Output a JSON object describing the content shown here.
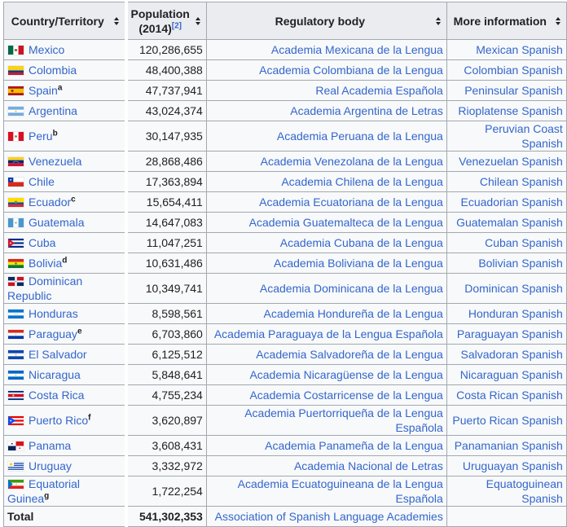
{
  "table": {
    "headers": {
      "country": "Country/Territory",
      "population": "Population (2014)",
      "population_line1": "Population",
      "population_line2": "(2014)",
      "population_ref": "[2]",
      "regulatory": "Regulatory body",
      "more_info": "More information"
    },
    "rows": [
      {
        "country": "Mexico",
        "note": "",
        "flag": "mexico-flag",
        "population": "120,286,655",
        "regulatory": "Academia Mexicana de la Lengua",
        "more_info": "Mexican Spanish"
      },
      {
        "country": "Colombia",
        "note": "",
        "flag": "colombia-flag",
        "population": "48,400,388",
        "regulatory": "Academia Colombiana de la Lengua",
        "more_info": "Colombian Spanish"
      },
      {
        "country": "Spain",
        "note": "a",
        "flag": "spain-flag",
        "population": "47,737,941",
        "regulatory": "Real Academia Española",
        "more_info": "Peninsular Spanish"
      },
      {
        "country": "Argentina",
        "note": "",
        "flag": "argentina-flag",
        "population": "43,024,374",
        "regulatory": "Academia Argentina de Letras",
        "more_info": "Rioplatense Spanish"
      },
      {
        "country": "Peru",
        "note": "b",
        "flag": "peru-flag",
        "population": "30,147,935",
        "regulatory": "Academia Peruana de la Lengua",
        "more_info": "Peruvian Coast Spanish"
      },
      {
        "country": "Venezuela",
        "note": "",
        "flag": "venezuela-flag",
        "population": "28,868,486",
        "regulatory": "Academia Venezolana de la Lengua",
        "more_info": "Venezuelan Spanish"
      },
      {
        "country": "Chile",
        "note": "",
        "flag": "chile-flag",
        "population": "17,363,894",
        "regulatory": "Academia Chilena de la Lengua",
        "more_info": "Chilean Spanish"
      },
      {
        "country": "Ecuador",
        "note": "c",
        "flag": "ecuador-flag",
        "population": "15,654,411",
        "regulatory": "Academia Ecuatoriana de la Lengua",
        "more_info": "Ecuadorian Spanish"
      },
      {
        "country": "Guatemala",
        "note": "",
        "flag": "guatemala-flag",
        "population": "14,647,083",
        "regulatory": "Academia Guatemalteca de la Lengua",
        "more_info": "Guatemalan Spanish"
      },
      {
        "country": "Cuba",
        "note": "",
        "flag": "cuba-flag",
        "population": "11,047,251",
        "regulatory": "Academia Cubana de la Lengua",
        "more_info": "Cuban Spanish"
      },
      {
        "country": "Bolivia",
        "note": "d",
        "flag": "bolivia-flag",
        "population": "10,631,486",
        "regulatory": "Academia Boliviana de la Lengua",
        "more_info": "Bolivian Spanish"
      },
      {
        "country": "Dominican Republic",
        "note": "",
        "flag": "dominican-republic-flag",
        "population": "10,349,741",
        "regulatory": "Academia Dominicana de la Lengua",
        "more_info": "Dominican Spanish"
      },
      {
        "country": "Honduras",
        "note": "",
        "flag": "honduras-flag",
        "population": "8,598,561",
        "regulatory": "Academia Hondureña de la Lengua",
        "more_info": "Honduran Spanish"
      },
      {
        "country": "Paraguay",
        "note": "e",
        "flag": "paraguay-flag",
        "population": "6,703,860",
        "regulatory": "Academia Paraguaya de la Lengua Española",
        "more_info": "Paraguayan Spanish"
      },
      {
        "country": "El Salvador",
        "note": "",
        "flag": "el-salvador-flag",
        "population": "6,125,512",
        "regulatory": "Academia Salvadoreña de la Lengua",
        "more_info": "Salvadoran Spanish"
      },
      {
        "country": "Nicaragua",
        "note": "",
        "flag": "nicaragua-flag",
        "population": "5,848,641",
        "regulatory": "Academia Nicaragüense de la Lengua",
        "more_info": "Nicaraguan Spanish"
      },
      {
        "country": "Costa Rica",
        "note": "",
        "flag": "costa-rica-flag",
        "population": "4,755,234",
        "regulatory": "Academia Costarricense de la Lengua",
        "more_info": "Costa Rican Spanish"
      },
      {
        "country": "Puerto Rico",
        "note": "f",
        "flag": "puerto-rico-flag",
        "population": "3,620,897",
        "regulatory": "Academia Puertorriqueña de la Lengua Española",
        "more_info": "Puerto Rican Spanish"
      },
      {
        "country": "Panama",
        "note": "",
        "flag": "panama-flag",
        "population": "3,608,431",
        "regulatory": "Academia Panameña de la Lengua",
        "more_info": "Panamanian Spanish"
      },
      {
        "country": "Uruguay",
        "note": "",
        "flag": "uruguay-flag",
        "population": "3,332,972",
        "regulatory": "Academia Nacional de Letras",
        "more_info": "Uruguayan Spanish"
      },
      {
        "country": "Equatorial Guinea",
        "note": "g",
        "flag": "equatorial-guinea-flag",
        "population": "1,722,254",
        "regulatory": "Academia Ecuatoguineana de la Lengua Española",
        "more_info": "Equatoguinean Spanish"
      }
    ],
    "total": {
      "label": "Total",
      "population": "541,302,353",
      "regulatory": "Association of Spanish Language Academies",
      "more_info": ""
    }
  },
  "colors": {
    "link": "#3366cc",
    "header_bg": "#eaecf0",
    "cell_bg": "#f8f9fa",
    "border": "#a2a9b1",
    "text": "#202122"
  }
}
